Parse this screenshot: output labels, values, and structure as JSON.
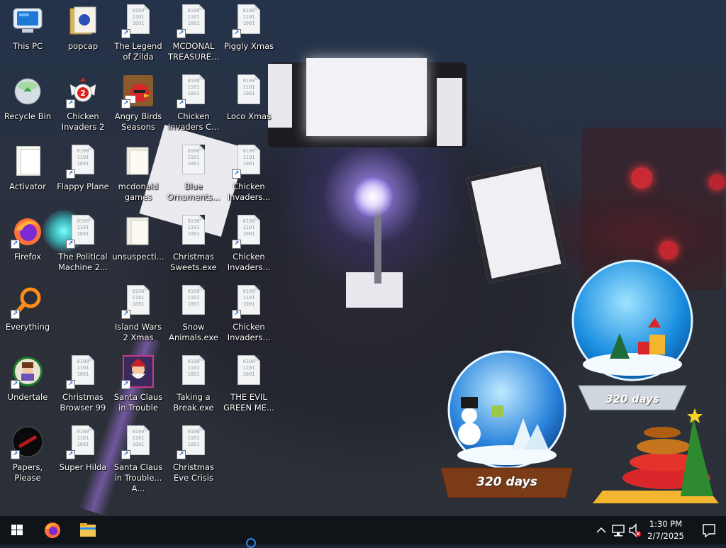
{
  "desktop": {
    "icons": [
      {
        "label": "This PC"
      },
      {
        "label": "popcap"
      },
      {
        "label": "The Legend of Zilda"
      },
      {
        "label": "MCDONAL TREASURE..."
      },
      {
        "label": "Piggly Xmas"
      },
      {
        "label": "Recycle Bin"
      },
      {
        "label": "Chicken Invaders 2"
      },
      {
        "label": "Angry Birds Seasons"
      },
      {
        "label": "Chicken Invaders C..."
      },
      {
        "label": "Loco Xmas"
      },
      {
        "label": "Activator"
      },
      {
        "label": "Flappy Plane"
      },
      {
        "label": "mcdonald games"
      },
      {
        "label": "Blue Ornaments..."
      },
      {
        "label": "Chicken Invaders..."
      },
      {
        "label": "Firefox"
      },
      {
        "label": "The Political Machine 2..."
      },
      {
        "label": "unsuspecti..."
      },
      {
        "label": "Christmas Sweets.exe"
      },
      {
        "label": "Chicken Invaders..."
      },
      {
        "label": "Everything"
      },
      {
        "label": "Island Wars 2 Xmas"
      },
      {
        "label": "Snow Animals.exe"
      },
      {
        "label": "Chicken Invaders..."
      },
      {
        "label": "Undertale"
      },
      {
        "label": "Christmas Browser 99"
      },
      {
        "label": "Santa Claus in Trouble"
      },
      {
        "label": "Taking a Break.exe"
      },
      {
        "label": "THE EVIL GREEN ME..."
      },
      {
        "label": "Papers, Please"
      },
      {
        "label": "Super Hilda"
      },
      {
        "label": "Santa Claus in Trouble... A..."
      },
      {
        "label": "Christmas Eve Crisis"
      }
    ],
    "gadgets": {
      "globe1_text": "320 days",
      "globe2_text": "320 days"
    },
    "binary_text": "0100\n1101\n1001"
  },
  "taskbar": {
    "time": "1:30 PM",
    "date": "2/7/2025",
    "pinned": [
      "start-icon",
      "firefox-icon",
      "file-explorer-icon"
    ],
    "tray": [
      "chevron-up-icon",
      "network-icon",
      "volume-muted-icon",
      "notification-icon"
    ]
  },
  "colors": {
    "taskbar_bg": "#101317",
    "accent_firefox": "#ff7139",
    "folder_yellow": "#f3c74f"
  }
}
